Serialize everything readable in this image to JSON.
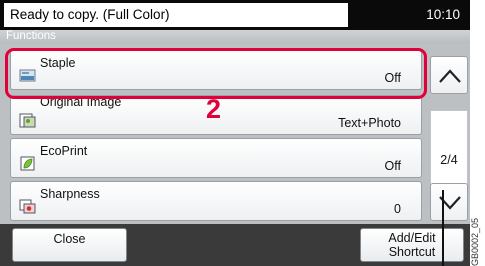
{
  "status": {
    "message": "Ready to copy. (Full Color)",
    "time": "10:10"
  },
  "section": {
    "title": "Functions"
  },
  "functions": [
    {
      "label": "Staple",
      "value": "Off",
      "icon": "staple-icon"
    },
    {
      "label": "Original Image",
      "value": "Text+Photo",
      "icon": "original-image-icon"
    },
    {
      "label": "EcoPrint",
      "value": "Off",
      "icon": "ecoprint-leaf-icon"
    },
    {
      "label": "Sharpness",
      "value": "0",
      "icon": "sharpness-icon"
    }
  ],
  "pager": {
    "page": "2/4",
    "up_icon": "chevron-up-icon",
    "down_icon": "chevron-down-icon"
  },
  "annotation": {
    "step": "2",
    "highlight_color": "#e0003a"
  },
  "footer": {
    "close_label": "Close",
    "add_edit_line1": "Add/Edit",
    "add_edit_line2": "Shortcut"
  },
  "figure_code": "GB0002_05"
}
